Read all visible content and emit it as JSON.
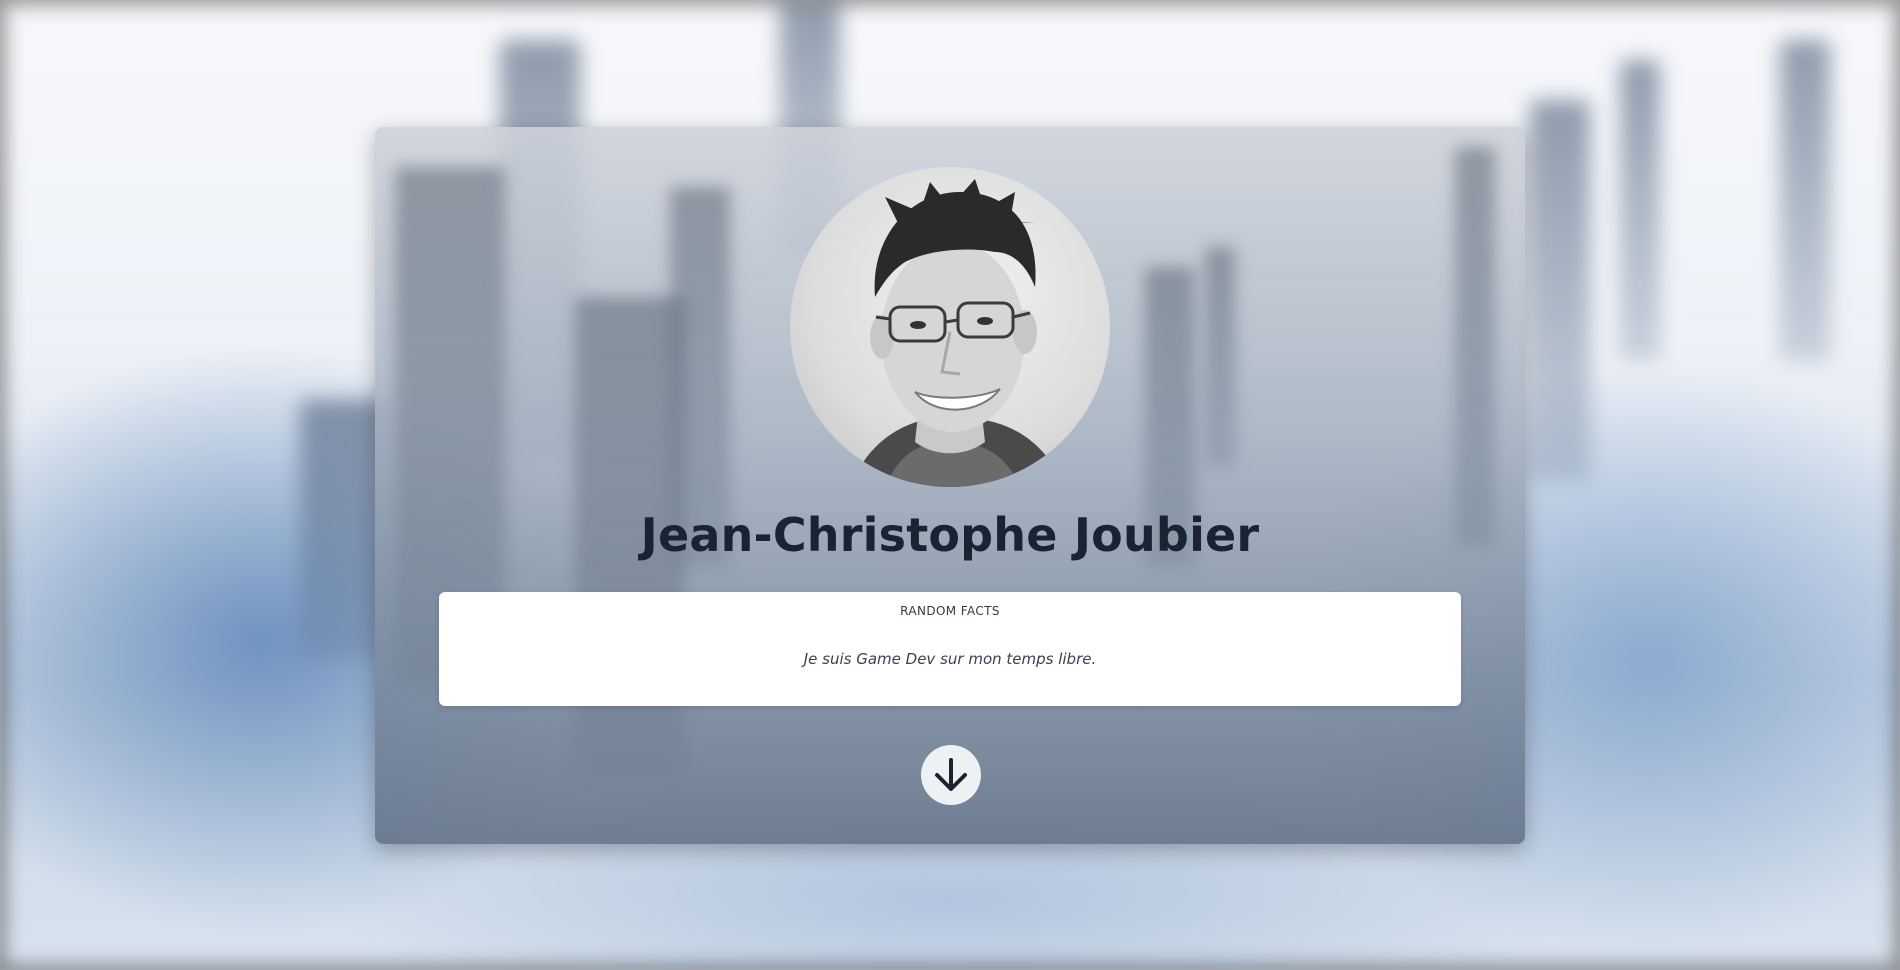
{
  "profile": {
    "name": "Jean-Christophe Joubier",
    "avatar_icon": "profile-photo"
  },
  "facts": {
    "title": "RANDOM FACTS",
    "text": "Je suis Game Dev sur mon temps libre."
  },
  "scroll_down": {
    "icon": "arrow-down-icon"
  },
  "colors": {
    "name_text": "#1b2232",
    "facts_bg": "#ffffff",
    "button_bg": "#eef0f3",
    "arrow": "#1b2232"
  }
}
